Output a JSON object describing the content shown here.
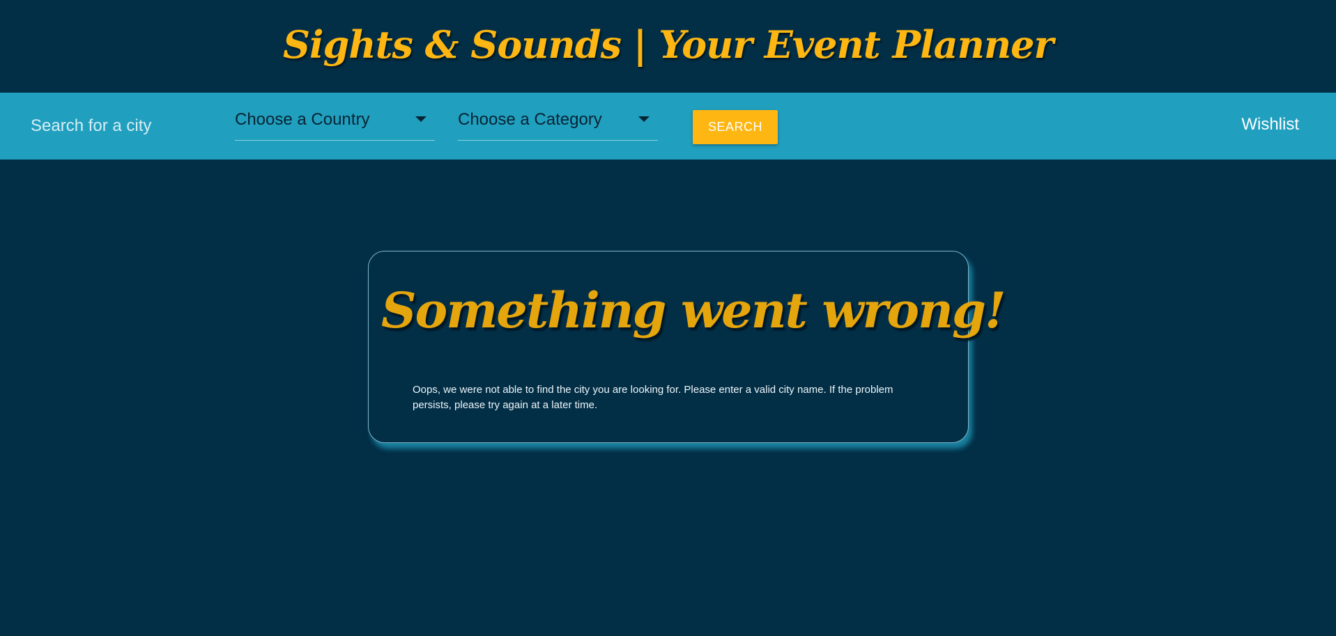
{
  "header": {
    "title": "Sights & Sounds | Your Event Planner"
  },
  "navbar": {
    "search": {
      "placeholder": "Search for a city",
      "value": ""
    },
    "country_select": {
      "selected": "Choose a Country"
    },
    "category_select": {
      "selected": "Choose a Category"
    },
    "search_button_label": "SEARCH",
    "wishlist_label": "Wishlist"
  },
  "error": {
    "title": "Something went wrong!",
    "message": "Oops, we were not able to find the city you are looking for. Please enter a valid city name. If the problem persists, please try again at a later time."
  },
  "colors": {
    "background": "#022e46",
    "navbar": "#219fbf",
    "accent": "#fdb612",
    "error_title": "#e5a50d"
  },
  "icons": {
    "country_dropdown": "caret-down-icon",
    "category_dropdown": "caret-down-icon"
  }
}
